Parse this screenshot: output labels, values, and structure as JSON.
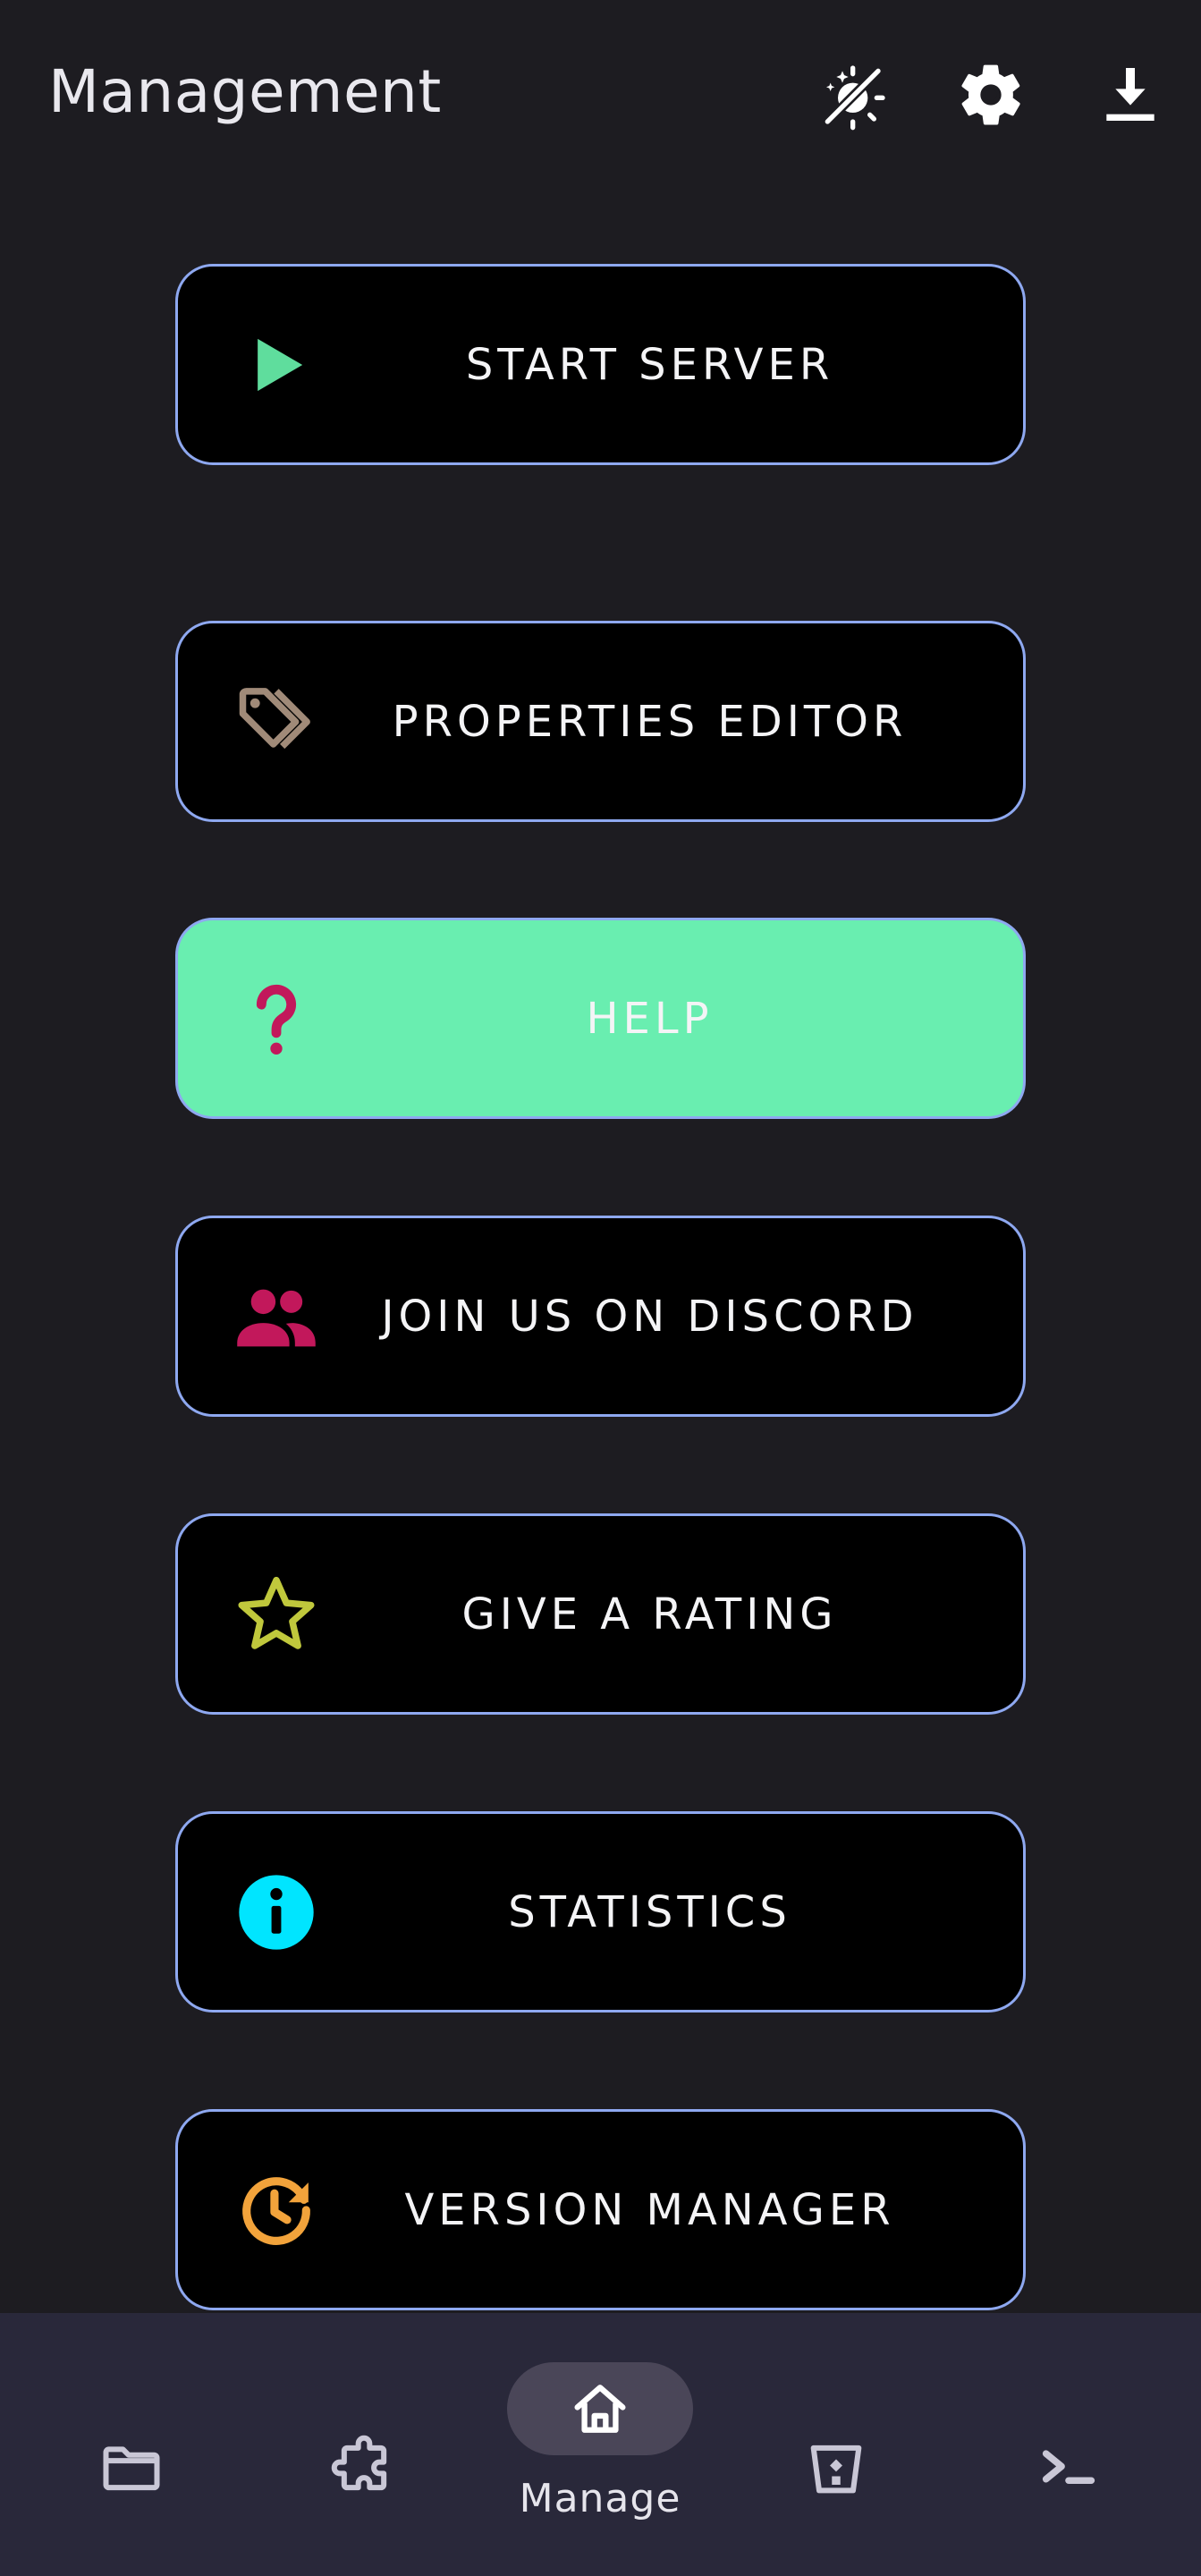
{
  "app": {
    "title": "Management"
  },
  "header_actions": [
    {
      "name": "theme-toggle-icon"
    },
    {
      "name": "gear-icon"
    },
    {
      "name": "download-icon"
    }
  ],
  "menu": {
    "start_server": {
      "label": "START SERVER",
      "icon": "play-icon",
      "icon_color": "#5fdd9d"
    },
    "properties_editor": {
      "label": "PROPERTIES EDITOR",
      "icon": "tags-icon",
      "icon_color": "#a08a78"
    },
    "help": {
      "label": "HELP",
      "icon": "question-icon",
      "icon_color": "#c2185b",
      "selected": true
    },
    "discord": {
      "label": "JOIN US ON DISCORD",
      "icon": "people-icon",
      "icon_color": "#c2185b"
    },
    "rating": {
      "label": "GIVE A RATING",
      "icon": "star-icon",
      "icon_color": "#c0c83c"
    },
    "statistics": {
      "label": "STATISTICS",
      "icon": "info-icon",
      "icon_color": "#00e5ff"
    },
    "version_manager": {
      "label": "VERSION MANAGER",
      "icon": "history-icon",
      "icon_color": "#f2a33b"
    }
  },
  "colors": {
    "background": "#1d1c21",
    "button_border": "#8ea8f0",
    "button_active": "#69eeb0",
    "nav_background": "#29283a"
  },
  "bottom_nav": {
    "items": [
      {
        "icon": "folder-icon"
      },
      {
        "icon": "puzzle-icon"
      },
      {
        "icon": "home-icon",
        "label": "Manage",
        "active": true
      },
      {
        "icon": "bucket-icon"
      },
      {
        "icon": "terminal-icon"
      }
    ]
  }
}
